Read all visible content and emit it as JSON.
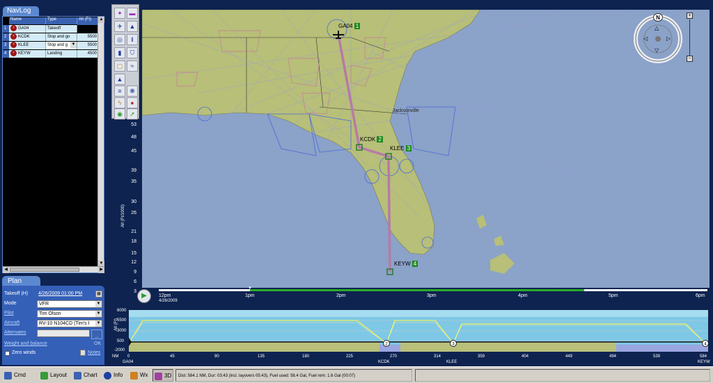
{
  "navlog": {
    "tab_label": "NavLog",
    "headers": [
      "Name",
      "Type",
      "Alt (Ft)"
    ],
    "rows": [
      {
        "num": "1",
        "name": "GA04",
        "type": "Takeoff",
        "alt": ""
      },
      {
        "num": "2",
        "name": "KCDK",
        "type": "Stop and go",
        "alt": "5500"
      },
      {
        "num": "3",
        "name": "KLEE",
        "type": "Stop and g",
        "alt": "5500"
      },
      {
        "num": "4",
        "name": "KEYW",
        "type": "Landing",
        "alt": "4500"
      }
    ]
  },
  "plan": {
    "tab_label": "Plan",
    "takeoff_label": "Takeoff (H)",
    "takeoff_value": "4/26/2009 01:00 PM",
    "mode_label": "Mode",
    "mode_value": "VFR",
    "pilot_label": "Pilot",
    "pilot_value": "Tim Olson",
    "aircraft_label": "Aircraft",
    "aircraft_value": "RV-10 N104CD (Tim's I",
    "alternates_label": "Alternates",
    "alternates_button": "...",
    "weight_label": "Weight and balance",
    "weight_ok": "OK",
    "zero_winds_label": "Zero winds",
    "notes_label": "Notes"
  },
  "map": {
    "waypoints": [
      {
        "id": "GA04",
        "num": "1"
      },
      {
        "id": "KCDK",
        "num": "2"
      },
      {
        "id": "KLEE",
        "num": "3"
      },
      {
        "id": "KEYW",
        "num": "4"
      }
    ],
    "city_label": "Jacksonville",
    "compass_label": "N",
    "route_color": "#b77aa8",
    "land_color": "#b7bf78",
    "water_color": "#8ba2c9"
  },
  "altitude_axis": {
    "label": "Alt (Ft/1000)",
    "ticks": [
      "53",
      "48",
      "45",
      "39",
      "35",
      "30",
      "26",
      "21",
      "18",
      "15",
      "12",
      "9",
      "6",
      "3"
    ]
  },
  "timeline": {
    "labels": [
      "12pm",
      "1pm",
      "2pm",
      "3pm",
      "4pm",
      "5pm",
      "6pm"
    ],
    "date": "4/26/2009"
  },
  "profile": {
    "y_label": "Alt (Ft)",
    "y_ticks": [
      "6000",
      "5500",
      "3000",
      "500",
      "-2000"
    ],
    "nm_label": "NM",
    "x_ticks": [
      "0",
      "45",
      "90",
      "135",
      "180",
      "225",
      "270",
      "314",
      "359",
      "404",
      "449",
      "494",
      "539",
      "584"
    ],
    "waypoint_labels": [
      "GA04",
      "KCDK",
      "KLEE",
      "KEYW"
    ],
    "markers": [
      "2",
      "3",
      "4"
    ]
  },
  "bottom_tabs": [
    {
      "label": "Cmd",
      "color": "#3a62b0"
    },
    {
      "label": "Layout",
      "color": "#3a9a3a"
    },
    {
      "label": "Chart",
      "color": "#3a62b0"
    },
    {
      "label": "Info",
      "color": "#2040a0"
    },
    {
      "label": "Wx",
      "color": "#d08020"
    },
    {
      "label": "3D",
      "color": "#a040a0"
    }
  ],
  "status": {
    "text": "Dist: 584.1 NM, Dur: 03:43 (incl. layovers 05:43), Fuel used: 58.4 Gal, Fuel rem: 1.6 Gal (00:07)"
  }
}
